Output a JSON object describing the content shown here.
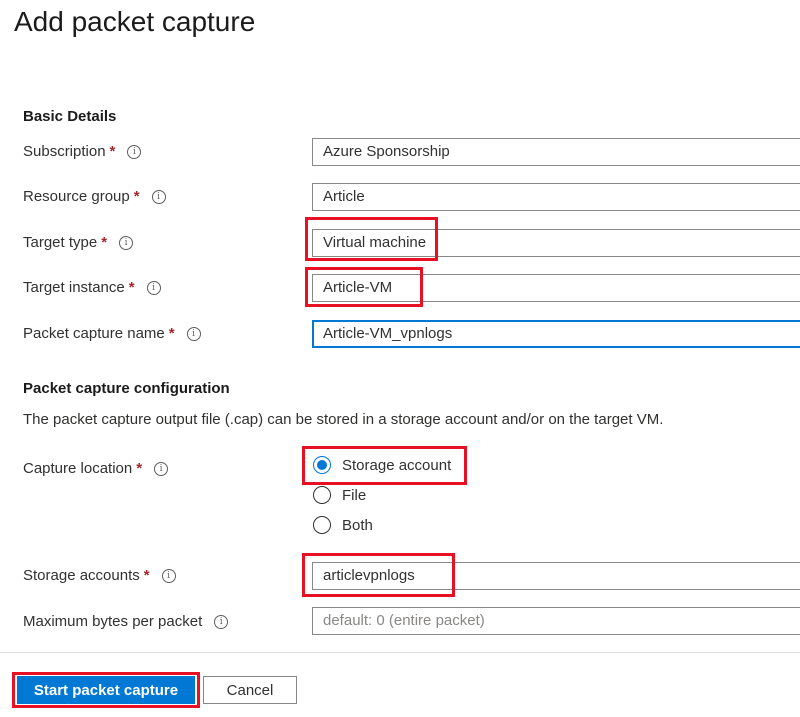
{
  "page": {
    "title": "Add packet capture"
  },
  "basic": {
    "heading": "Basic Details",
    "subscription": {
      "label": "Subscription",
      "value": "Azure Sponsorship"
    },
    "resource_group": {
      "label": "Resource group",
      "value": "Article"
    },
    "target_type": {
      "label": "Target type",
      "value": "Virtual machine"
    },
    "target_instance": {
      "label": "Target instance",
      "value": "Article-VM"
    },
    "capture_name": {
      "label": "Packet capture name",
      "value": "Article-VM_vpnlogs"
    }
  },
  "config": {
    "heading": "Packet capture configuration",
    "description": "The packet capture output file (.cap) can be stored in a storage account and/or on the target VM.",
    "capture_location": {
      "label": "Capture location",
      "options": [
        "Storage account",
        "File",
        "Both"
      ],
      "selected": "Storage account"
    },
    "storage_accounts": {
      "label": "Storage accounts",
      "value": "articlevpnlogs"
    },
    "max_bytes": {
      "label": "Maximum bytes per packet",
      "placeholder": "default: 0 (entire packet)"
    }
  },
  "common": {
    "required_mark": "*",
    "info_glyph": "i"
  },
  "footer": {
    "start_label": "Start packet capture",
    "cancel_label": "Cancel"
  },
  "colors": {
    "accent": "#0078d4",
    "highlight": "#e81123",
    "required": "#a4262c"
  }
}
